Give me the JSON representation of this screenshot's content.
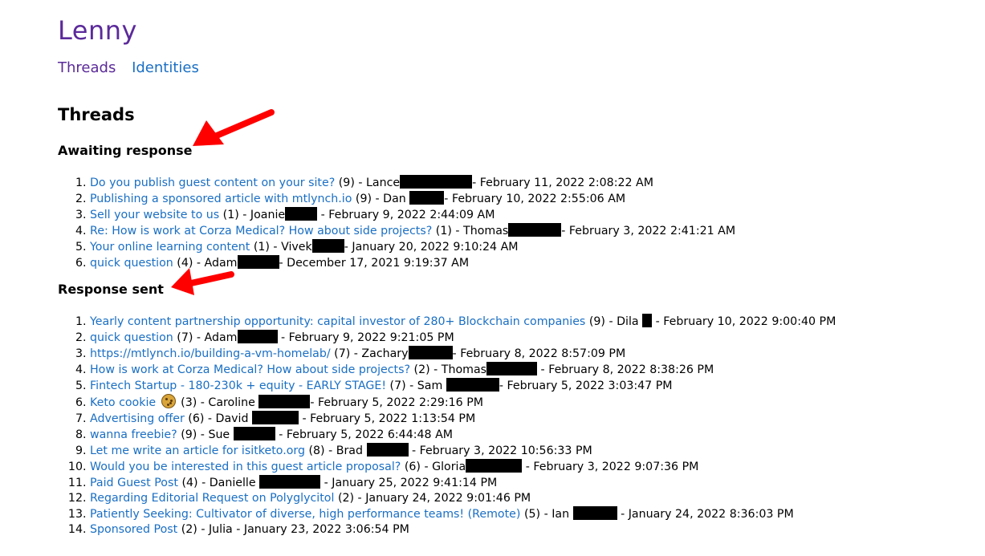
{
  "site": {
    "title": "Lenny"
  },
  "nav": {
    "threads": "Threads",
    "identities": "Identities"
  },
  "page": {
    "heading": "Threads"
  },
  "sections": {
    "awaiting": {
      "heading": "Awaiting response",
      "items": [
        {
          "title": "Do you publish guest content on your site?",
          "count": "(9)",
          "name": "Lance",
          "date": "February 11, 2022 2:08:22 AM"
        },
        {
          "title": "Publishing a sponsored article with mtlynch.io",
          "count": "(9)",
          "name": "Dan",
          "date": "February 10, 2022 2:55:06 AM"
        },
        {
          "title": "Sell your website to us",
          "count": "(1)",
          "name": "Joanie",
          "date": "February 9, 2022 2:44:09 AM"
        },
        {
          "title": "Re: How is work at Corza Medical? How about side projects?",
          "count": "(1)",
          "name": "Thomas",
          "date": "February 3, 2022 2:41:21 AM"
        },
        {
          "title": "Your online learning content",
          "count": "(1)",
          "name": "Vivek",
          "date": "January 20, 2022 9:10:24 AM"
        },
        {
          "title": "quick question",
          "count": "(4)",
          "name": "Adam",
          "date": "December 17, 2021 9:19:37 AM"
        }
      ]
    },
    "sent": {
      "heading": "Response sent",
      "items": [
        {
          "title": "Yearly content partnership opportunity: capital investor of 280+ Blockchain companies",
          "count": "(9)",
          "name": "Dila",
          "date": "February 10, 2022 9:00:40 PM"
        },
        {
          "title": "quick question",
          "count": "(7)",
          "name": "Adam",
          "date": "February 9, 2022 9:21:05 PM"
        },
        {
          "title": "https://mtlynch.io/building-a-vm-homelab/",
          "count": "(7)",
          "name": "Zachary",
          "date": "February 8, 2022 8:57:09 PM"
        },
        {
          "title": "How is work at Corza Medical? How about side projects?",
          "count": "(2)",
          "name": "Thomas",
          "date": "February 8, 2022 8:38:26 PM"
        },
        {
          "title": "Fintech Startup - 180-230k + equity - EARLY STAGE!",
          "count": "(7)",
          "name": "Sam",
          "date": "February 5, 2022 3:03:47 PM"
        },
        {
          "title": "Keto cookie",
          "count": "(3)",
          "name": "Caroline",
          "date": "February 5, 2022 2:29:16 PM"
        },
        {
          "title": "Advertising offer",
          "count": "(6)",
          "name": "David",
          "date": "February 5, 2022 1:13:54 PM"
        },
        {
          "title": "wanna freebie?",
          "count": "(9)",
          "name": "Sue",
          "date": "February 5, 2022 6:44:48 AM"
        },
        {
          "title": "Let me write an article for isitketo.org",
          "count": "(8)",
          "name": "Brad",
          "date": "February 3, 2022 10:56:33 PM"
        },
        {
          "title": "Would you be interested in this guest article proposal?",
          "count": "(6)",
          "name": "Gloria",
          "date": "February 3, 2022 9:07:36 PM"
        },
        {
          "title": "Paid Guest Post",
          "count": "(4)",
          "name": "Danielle",
          "date": "January 25, 2022 9:41:14 PM"
        },
        {
          "title": "Regarding Editorial Request on Polyglycitol",
          "count": "(2)",
          "name": "",
          "date": "January 24, 2022 9:01:46 PM"
        },
        {
          "title": "Patiently Seeking: Cultivator of diverse, high performance teams! (Remote)",
          "count": "(5)",
          "name": "Ian",
          "date": "January 24, 2022 8:36:03 PM"
        },
        {
          "title": "Sponsored Post",
          "count": "(2)",
          "name": "Julia",
          "date": "January 23, 2022 3:06:54 PM"
        }
      ]
    }
  },
  "icons": {
    "keto_cookie": "cookie-icon",
    "annotation": "red-arrow-icon"
  },
  "colors": {
    "link": "#1a6fc4",
    "visited": "#5b2a9a",
    "arrow": "#ff0000"
  }
}
